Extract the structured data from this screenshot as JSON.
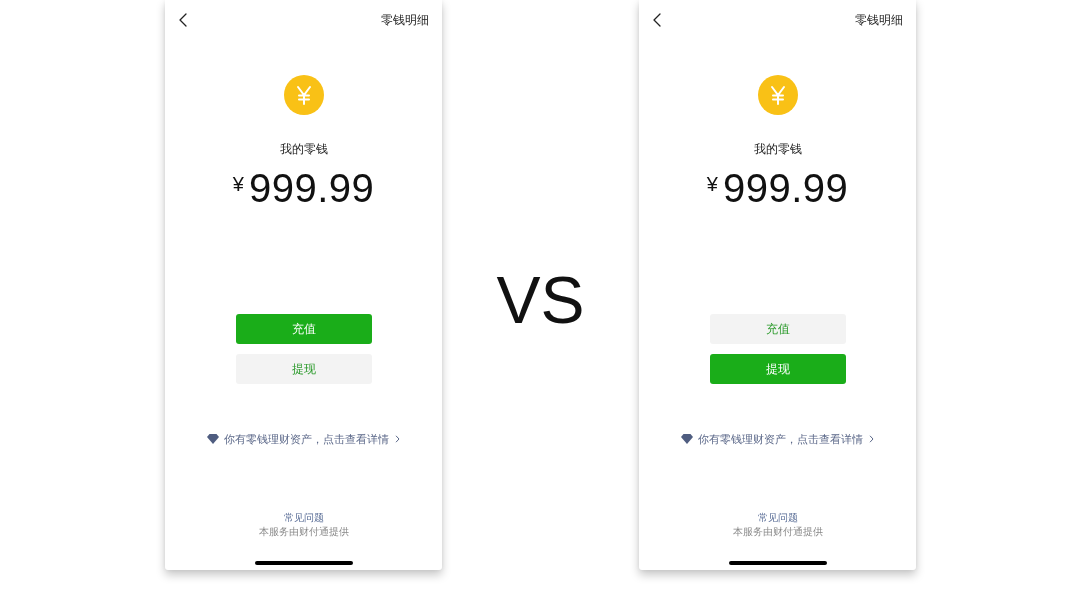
{
  "screens": [
    {
      "header": {
        "title": "零钱明细"
      },
      "balance_label": "我的零钱",
      "currency": "¥",
      "amount": "999.99",
      "buttons": [
        {
          "label": "充值",
          "primary": true
        },
        {
          "label": "提现",
          "primary": false
        }
      ],
      "wealth_link": "你有零钱理财资产，点击查看详情",
      "faq_link": "常见问题",
      "provider_note": "本服务由财付通提供"
    },
    {
      "header": {
        "title": "零钱明细"
      },
      "balance_label": "我的零钱",
      "currency": "¥",
      "amount": "999.99",
      "buttons": [
        {
          "label": "充值",
          "primary": false
        },
        {
          "label": "提现",
          "primary": true
        }
      ],
      "wealth_link": "你有零钱理财资产，点击查看详情",
      "faq_link": "常见问题",
      "provider_note": "本服务由财付通提供"
    }
  ],
  "comparison_label": "VS"
}
